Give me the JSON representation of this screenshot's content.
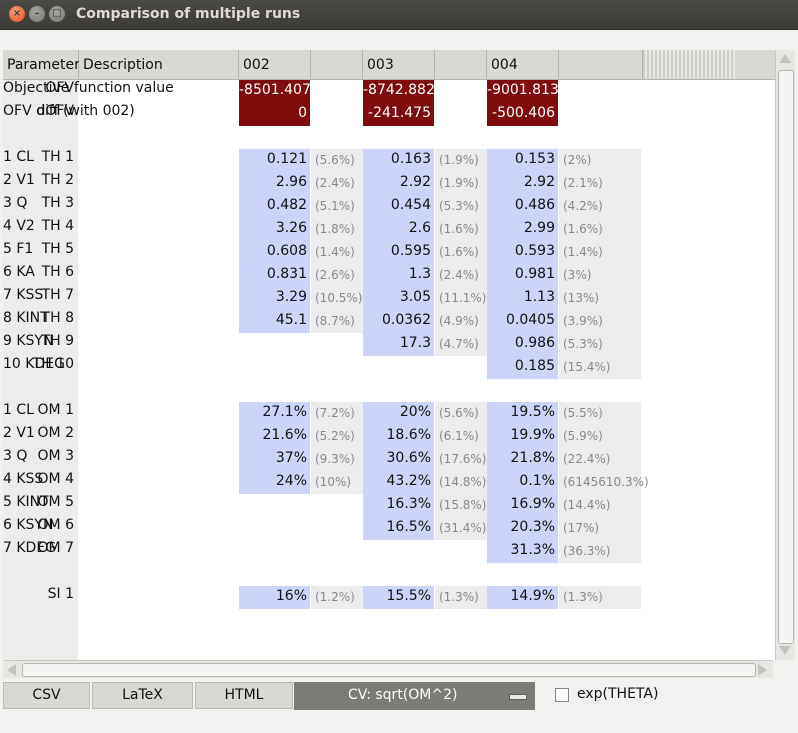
{
  "window": {
    "title": "Comparison of multiple runs"
  },
  "header": {
    "parameter": "Parameter",
    "description": "Description",
    "runs": [
      "002",
      "003",
      "004"
    ]
  },
  "ofv_rows": [
    {
      "name": "OFV",
      "desc": "Objective function value",
      "values": [
        "-8501.407",
        "-8742.882",
        "-9001.813"
      ]
    },
    {
      "name": "dOFV",
      "desc": "OFV diff (with 002)",
      "values": [
        "0",
        "-241.475",
        "-500.406"
      ]
    }
  ],
  "theta_rows": [
    {
      "name": "TH 1",
      "desc": "1 CL",
      "cells": [
        [
          "0.121",
          "(5.6%)"
        ],
        [
          "0.163",
          "(1.9%)"
        ],
        [
          "0.153",
          "(2%)"
        ]
      ]
    },
    {
      "name": "TH 2",
      "desc": "2 V1",
      "cells": [
        [
          "2.96",
          "(2.4%)"
        ],
        [
          "2.92",
          "(1.9%)"
        ],
        [
          "2.92",
          "(2.1%)"
        ]
      ]
    },
    {
      "name": "TH 3",
      "desc": "3 Q",
      "cells": [
        [
          "0.482",
          "(5.1%)"
        ],
        [
          "0.454",
          "(5.3%)"
        ],
        [
          "0.486",
          "(4.2%)"
        ]
      ]
    },
    {
      "name": "TH 4",
      "desc": "4 V2",
      "cells": [
        [
          "3.26",
          "(1.8%)"
        ],
        [
          "2.6",
          "(1.6%)"
        ],
        [
          "2.99",
          "(1.6%)"
        ]
      ]
    },
    {
      "name": "TH 5",
      "desc": "5 F1",
      "cells": [
        [
          "0.608",
          "(1.4%)"
        ],
        [
          "0.595",
          "(1.6%)"
        ],
        [
          "0.593",
          "(1.4%)"
        ]
      ]
    },
    {
      "name": "TH 6",
      "desc": "6 KA",
      "cells": [
        [
          "0.831",
          "(2.6%)"
        ],
        [
          "1.3",
          "(2.4%)"
        ],
        [
          "0.981",
          "(3%)"
        ]
      ]
    },
    {
      "name": "TH 7",
      "desc": "7 KSS",
      "cells": [
        [
          "3.29",
          "(10.5%)"
        ],
        [
          "3.05",
          "(11.1%)"
        ],
        [
          "1.13",
          "(13%)"
        ]
      ]
    },
    {
      "name": "TH 8",
      "desc": "8 KINT",
      "cells": [
        [
          "45.1",
          "(8.7%)"
        ],
        [
          "0.0362",
          "(4.9%)"
        ],
        [
          "0.0405",
          "(3.9%)"
        ]
      ]
    },
    {
      "name": "TH 9",
      "desc": "9 KSYN",
      "cells": [
        null,
        [
          "17.3",
          "(4.7%)"
        ],
        [
          "0.986",
          "(5.3%)"
        ]
      ]
    },
    {
      "name": "TH 10",
      "desc": "10 KDEG",
      "cells": [
        null,
        null,
        [
          "0.185",
          "(15.4%)"
        ]
      ]
    }
  ],
  "omega_rows": [
    {
      "name": "OM 1",
      "desc": "1 CL",
      "cells": [
        [
          "27.1%",
          "(7.2%)"
        ],
        [
          "20%",
          "(5.6%)"
        ],
        [
          "19.5%",
          "(5.5%)"
        ]
      ]
    },
    {
      "name": "OM 2",
      "desc": "2 V1",
      "cells": [
        [
          "21.6%",
          "(5.2%)"
        ],
        [
          "18.6%",
          "(6.1%)"
        ],
        [
          "19.9%",
          "(5.9%)"
        ]
      ]
    },
    {
      "name": "OM 3",
      "desc": "3 Q",
      "cells": [
        [
          "37%",
          "(9.3%)"
        ],
        [
          "30.6%",
          "(17.6%)"
        ],
        [
          "21.8%",
          "(22.4%)"
        ]
      ]
    },
    {
      "name": "OM 4",
      "desc": "4 KSS",
      "cells": [
        [
          "24%",
          "(10%)"
        ],
        [
          "43.2%",
          "(14.8%)"
        ],
        [
          "0.1%",
          "(6145610.3%)"
        ]
      ]
    },
    {
      "name": "OM 5",
      "desc": "5 KINT",
      "cells": [
        null,
        [
          "16.3%",
          "(15.8%)"
        ],
        [
          "16.9%",
          "(14.4%)"
        ]
      ]
    },
    {
      "name": "OM 6",
      "desc": "6 KSYN",
      "cells": [
        null,
        [
          "16.5%",
          "(31.4%)"
        ],
        [
          "20.3%",
          "(17%)"
        ]
      ]
    },
    {
      "name": "OM 7",
      "desc": "7 KDEG",
      "cells": [
        null,
        null,
        [
          "31.3%",
          "(36.3%)"
        ]
      ]
    }
  ],
  "sigma_rows": [
    {
      "name": "SI 1",
      "desc": "",
      "cells": [
        [
          "16%",
          "(1.2%)"
        ],
        [
          "15.5%",
          "(1.3%)"
        ],
        [
          "14.9%",
          "(1.3%)"
        ]
      ]
    }
  ],
  "bottom": {
    "csv": "CSV",
    "latex": "LaTeX",
    "html": "HTML",
    "cv_select": "CV: sqrt(OM^2)",
    "exp_theta_label": "exp(THETA)",
    "exp_theta_checked": false
  },
  "colors": {
    "ofv_bg": "#7e0c0c",
    "value_bg": "#ccd4fa",
    "rse_bg": "#ececec",
    "titlebar": "#3c3b37"
  }
}
